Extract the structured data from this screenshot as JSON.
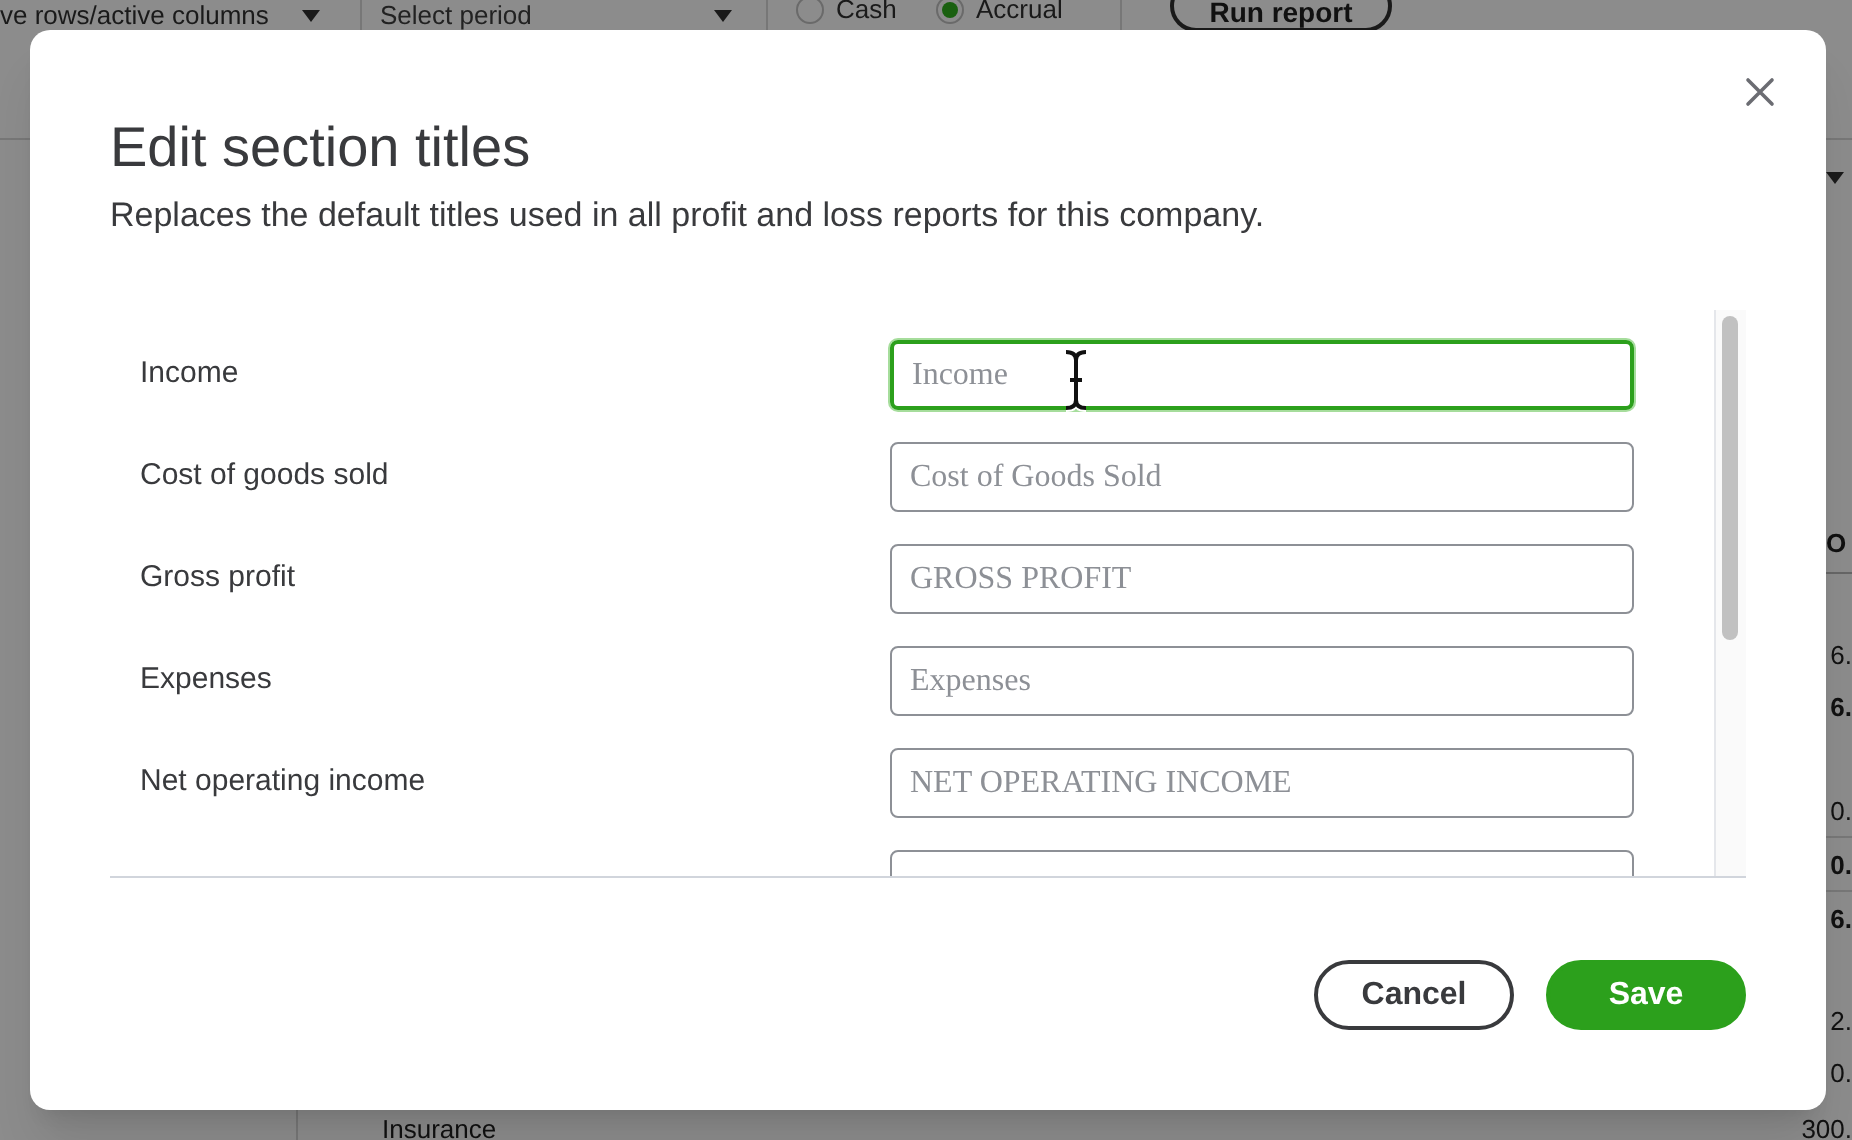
{
  "background_page": {
    "toolbar": {
      "rows_filter": "ve rows/active columns",
      "period_select": "Select period",
      "accounting_methods": [
        {
          "label": "Cash",
          "selected": false
        },
        {
          "label": "Accrual",
          "selected": true
        }
      ],
      "run_button": "Run report"
    },
    "report": {
      "column_header": "O",
      "amounts": [
        {
          "text": "6.",
          "bold": false
        },
        {
          "text": "6.",
          "bold": true
        },
        {
          "text": "0.",
          "bold": false
        },
        {
          "text": "0.",
          "bold": true
        },
        {
          "text": "6.",
          "bold": true
        },
        {
          "text": "2.",
          "bold": false
        },
        {
          "text": "0.",
          "bold": false
        }
      ],
      "last_row": {
        "label": "Insurance",
        "amount": "300."
      }
    }
  },
  "dialog": {
    "title": "Edit section titles",
    "description": "Replaces the default titles used in all profit and loss reports for this company.",
    "fields": [
      {
        "label": "Income",
        "placeholder": "Income",
        "focused": true
      },
      {
        "label": "Cost of goods sold",
        "placeholder": "Cost of Goods Sold",
        "focused": false
      },
      {
        "label": "Gross profit",
        "placeholder": "GROSS PROFIT",
        "focused": false
      },
      {
        "label": "Expenses",
        "placeholder": "Expenses",
        "focused": false
      },
      {
        "label": "Net operating income",
        "placeholder": "NET OPERATING INCOME",
        "focused": false
      }
    ],
    "buttons": [
      {
        "label": "Cancel",
        "kind": "secondary"
      },
      {
        "label": "Save",
        "kind": "primary"
      }
    ]
  }
}
